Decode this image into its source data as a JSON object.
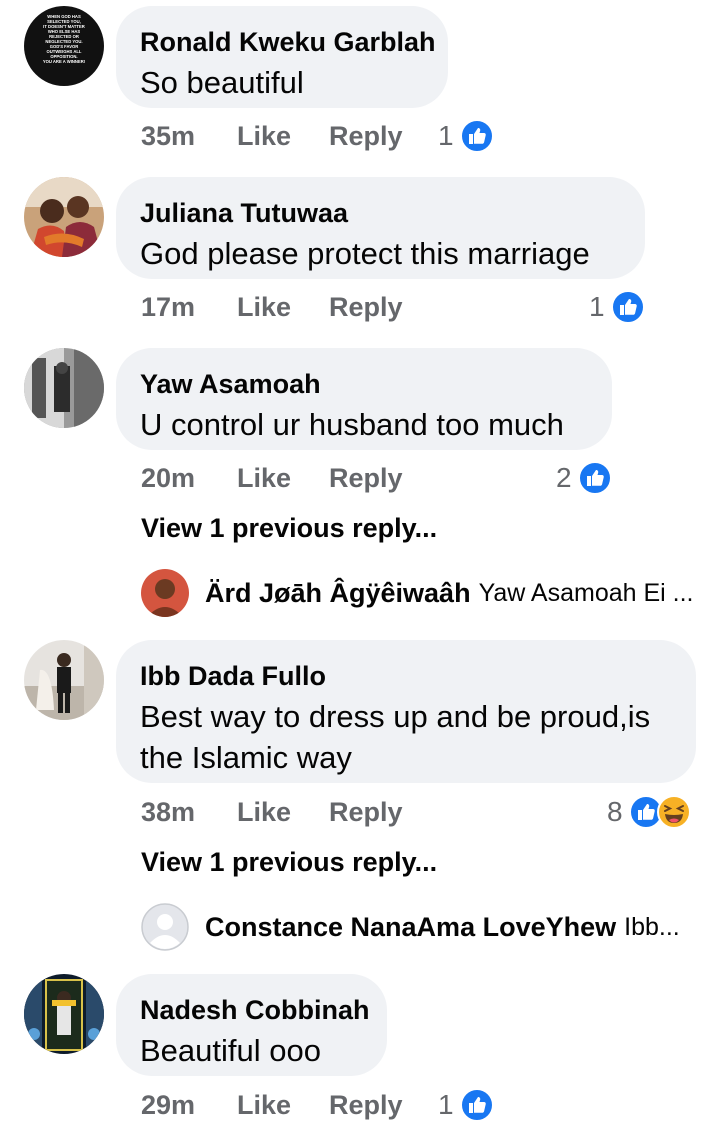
{
  "comments": [
    {
      "author": "Ronald Kweku Garblah",
      "text": "So beautiful",
      "time": "35m",
      "like": "Like",
      "reply": "Reply",
      "reaction_count": "1",
      "avatar_text": "WHEN GOD HAS SELECTED YOU, IT DOESN'T MATTER WHO ELSE HAS REJECTED OR NEGLECTED YOU. GOD'S FAVOR OUTWEIGHS ALL OPPOSITION. YOU ARE A WINNER!"
    },
    {
      "author": "Juliana Tutuwaa",
      "text": "God please protect this marriage",
      "time": "17m",
      "like": "Like",
      "reply": "Reply",
      "reaction_count": "1"
    },
    {
      "author": "Yaw Asamoah",
      "text": "U control ur husband too much",
      "time": "20m",
      "like": "Like",
      "reply": "Reply",
      "reaction_count": "2",
      "view_previous": "View 1 previous reply...",
      "latest_reply": {
        "author": "Ärd Jøāh Âgÿêiwaâh",
        "text": "Yaw Asamoah Ei ..."
      }
    },
    {
      "author": "Ibb Dada Fullo",
      "text": "Best way to dress up and be proud,is the Islamic way",
      "time": "38m",
      "like": "Like",
      "reply": "Reply",
      "reaction_count": "8",
      "view_previous": "View 1 previous reply...",
      "latest_reply": {
        "author": "Constance NanaAma LoveYhew",
        "text": "Ibb..."
      }
    },
    {
      "author": "Nadesh Cobbinah",
      "text": "Beautiful ooo",
      "time": "29m",
      "like": "Like",
      "reply": "Reply",
      "reaction_count": "1"
    }
  ],
  "colors": {
    "bubble": "#f0f2f5",
    "meta_text": "#65676b",
    "like_blue": "#1877f2",
    "haha_yellow": "#f7b125"
  },
  "icons": [
    "like-reaction-icon",
    "haha-reaction-icon",
    "default-avatar-icon"
  ]
}
